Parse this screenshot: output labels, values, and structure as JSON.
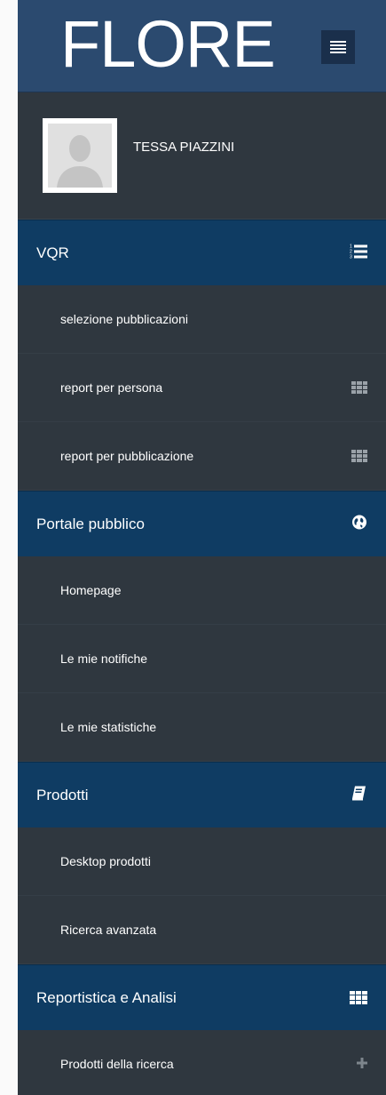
{
  "header": {
    "logo": "FLORE"
  },
  "profile": {
    "name": "TESSA PIAZZINI"
  },
  "menu": {
    "vqr": {
      "label": "VQR",
      "icon": "ordered-list-icon",
      "items": [
        {
          "label": "selezione pubblicazioni"
        },
        {
          "label": "report per persona",
          "icon": "table-icon"
        },
        {
          "label": "report per pubblicazione",
          "icon": "table-icon"
        }
      ]
    },
    "portale": {
      "label": "Portale pubblico",
      "icon": "globe-icon",
      "items": [
        {
          "label": "Homepage"
        },
        {
          "label": "Le mie notifiche"
        },
        {
          "label": "Le mie statistiche"
        }
      ]
    },
    "prodotti": {
      "label": "Prodotti",
      "icon": "book-icon",
      "items": [
        {
          "label": "Desktop prodotti"
        },
        {
          "label": "Ricerca avanzata"
        }
      ]
    },
    "report": {
      "label": "Reportistica e Analisi",
      "icon": "table-icon",
      "items": [
        {
          "label": "Prodotti della ricerca",
          "icon": "plus-icon"
        }
      ]
    }
  },
  "colors": {
    "topbar": "#2b4a6f",
    "section": "#0f3c63",
    "sidebar": "#2f373f"
  }
}
